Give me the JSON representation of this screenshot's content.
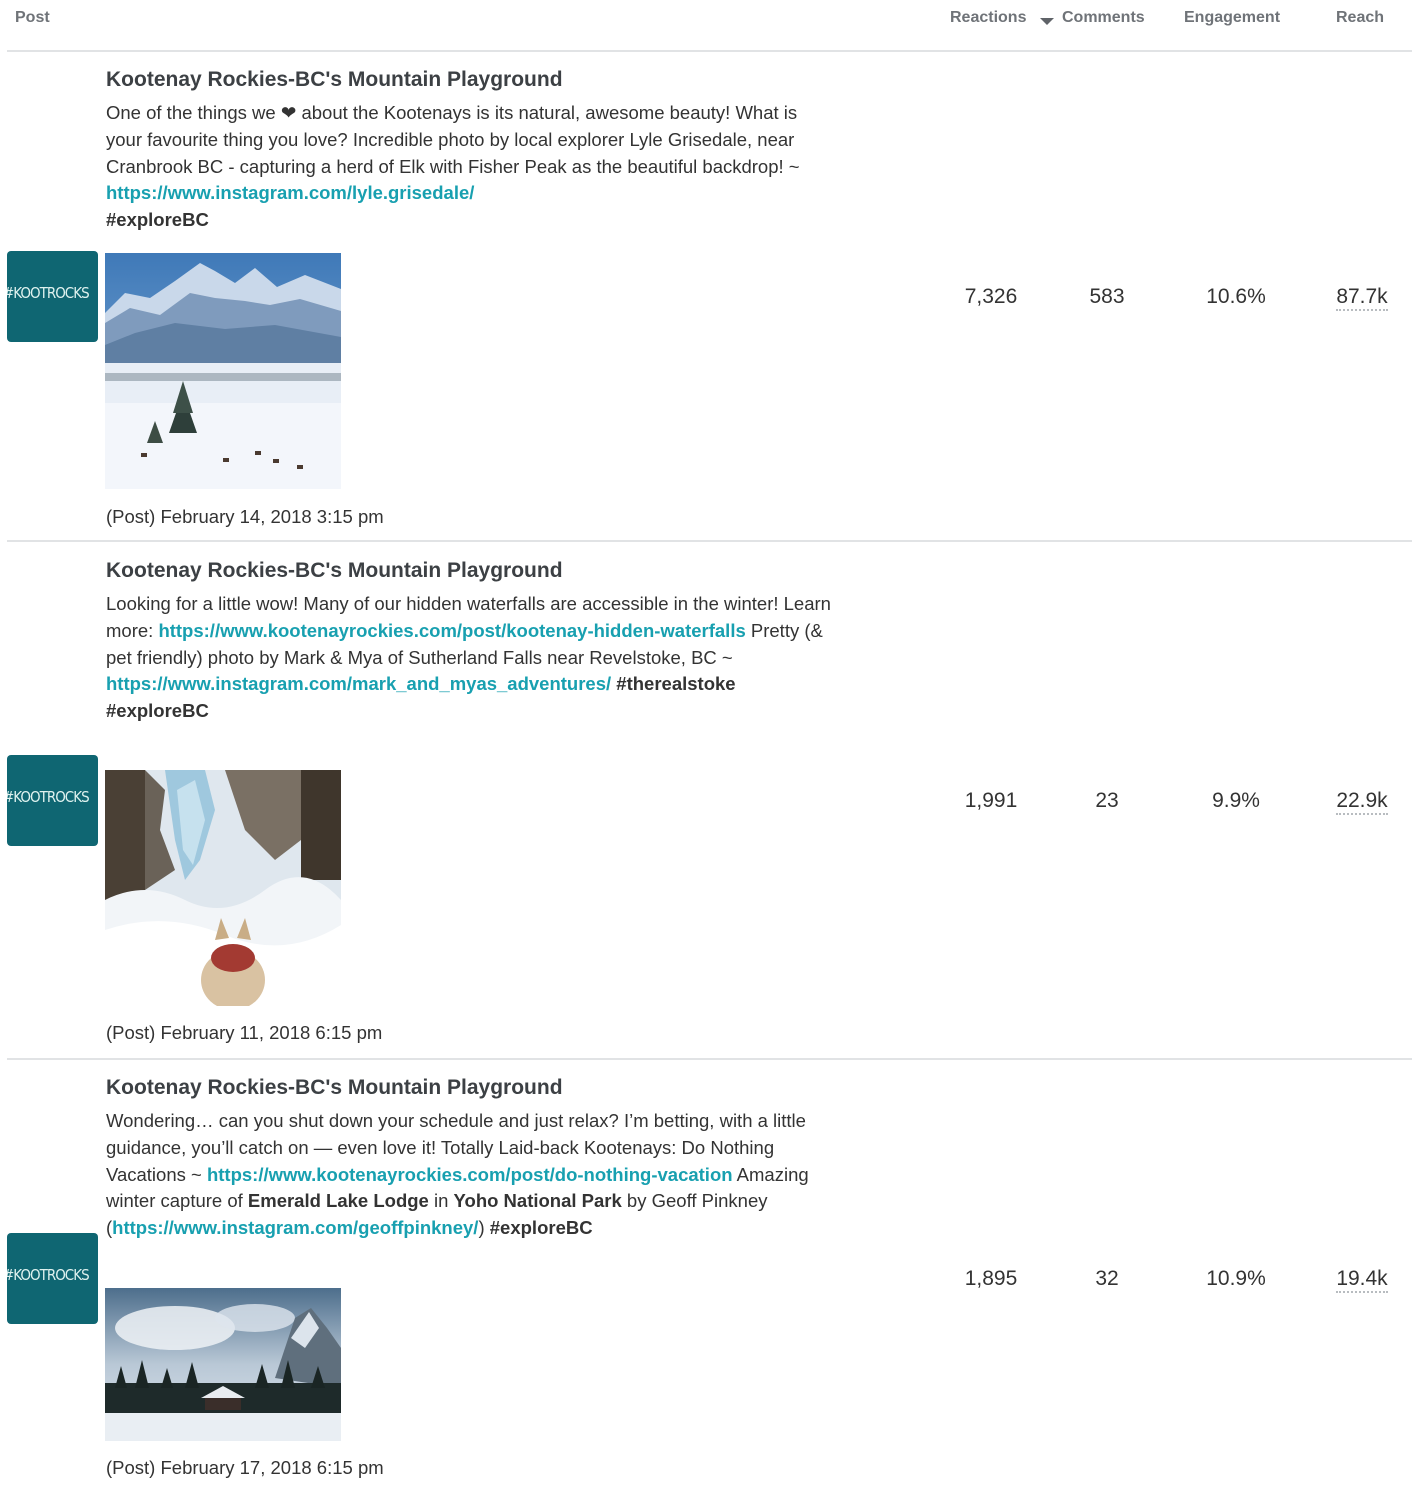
{
  "header": {
    "post": "Post",
    "reactions": "Reactions",
    "comments": "Comments",
    "engagement": "Engagement",
    "reach": "Reach"
  },
  "posts": [
    {
      "avatar_text": "#KOOTROCKS",
      "title": "Kootenay Rockies-BC's Mountain Playground",
      "text_1": "One of the things we ❤ about the Kootenays is its natural, awesome beauty! What is your favourite thing you love? Incredible photo by local explorer Lyle Grisedale, near Cranbrook BC - capturing a herd of Elk with Fisher Peak as the beautiful backdrop! ~ ",
      "link_1": "https://www.instagram.com/lyle.grisedale/",
      "tag_1": "#exploreBC",
      "date": "(Post) February 14, 2018 3:15 pm",
      "reactions": "7,326",
      "comments": "583",
      "engagement": "10.6%",
      "reach": "87.7k"
    },
    {
      "avatar_text": "#KOOTROCKS",
      "title": "Kootenay Rockies-BC's Mountain Playground",
      "text_1": "Looking for a little wow! Many of our hidden waterfalls are accessible in the winter! Learn more: ",
      "link_1": "https://www.kootenayrockies.com/post/kootenay-hidden-waterfalls",
      "text_2": " Pretty (& pet friendly) photo by Mark & Mya of Sutherland Falls near Revelstoke, BC ~ ",
      "link_2": "https://www.instagram.com/mark_and_myas_adventures/",
      "tag_1": "#therealstoke",
      "tag_2": "#exploreBC",
      "date": "(Post) February 11, 2018 6:15 pm",
      "reactions": "1,991",
      "comments": "23",
      "engagement": "9.9%",
      "reach": "22.9k"
    },
    {
      "avatar_text": "#KOOTROCKS",
      "title": "Kootenay Rockies-BC's Mountain Playground",
      "text_1": "Wondering… can you shut down your schedule and just relax? I’m betting, with a little guidance, you’ll catch on — even love it! Totally Laid-back Kootenays: Do Nothing Vacations ~ ",
      "link_1": "https://www.kootenayrockies.com/post/do-nothing-vacation",
      "text_2": " Amazing winter capture of ",
      "bold_1": "Emerald Lake Lodge",
      "text_3": " in ",
      "bold_2": "Yoho National Park",
      "text_4": " by Geoff Pinkney (",
      "link_2": "https://www.instagram.com/geoffpinkney/",
      "text_5": ") ",
      "tag_1": "#exploreBC",
      "date": "(Post) February 17, 2018 6:15 pm",
      "reactions": "1,895",
      "comments": "32",
      "engagement": "10.9%",
      "reach": "19.4k"
    }
  ],
  "colors": {
    "link": "#18a0b0",
    "avatar_bg": "#0f6672",
    "divider": "#e1e3e5",
    "header_text": "#6f7378"
  }
}
